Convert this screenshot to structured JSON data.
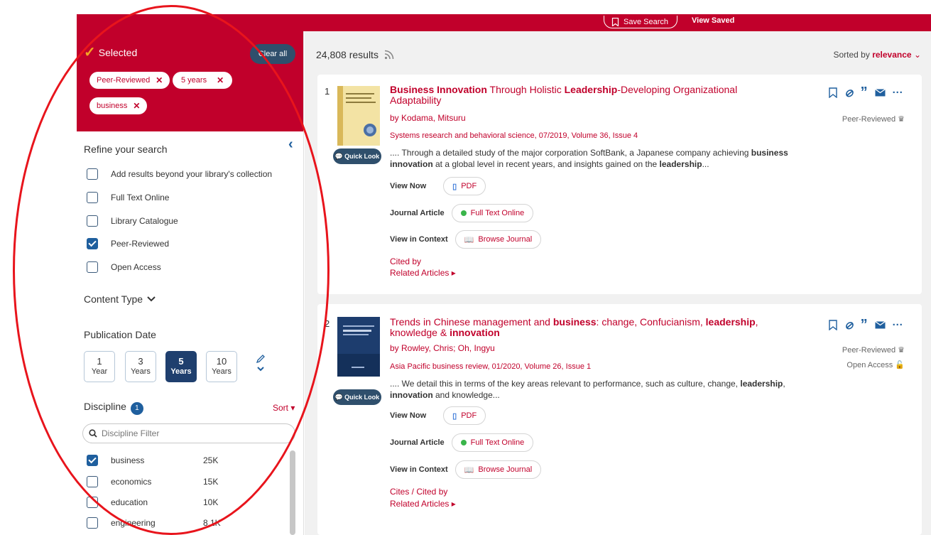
{
  "topbar": {
    "save_search": "Save Search",
    "view_saved": "View Saved"
  },
  "sidebar": {
    "selected_title": "Selected",
    "clear_all": "Clear all",
    "chips": [
      "Peer-Reviewed",
      "5 years",
      "business"
    ],
    "refine_title": "Refine your search",
    "filters": [
      {
        "label": "Add results beyond your library's collection",
        "checked": false
      },
      {
        "label": "Full Text Online",
        "checked": false
      },
      {
        "label": "Library Catalogue",
        "checked": false
      },
      {
        "label": "Peer-Reviewed",
        "checked": true
      },
      {
        "label": "Open Access",
        "checked": false
      }
    ],
    "content_type": "Content Type",
    "publication_date": "Publication Date",
    "years": [
      {
        "num": "1",
        "unit": "Year",
        "active": false
      },
      {
        "num": "3",
        "unit": "Years",
        "active": false
      },
      {
        "num": "5",
        "unit": "Years",
        "active": true
      },
      {
        "num": "10",
        "unit": "Years",
        "active": false
      }
    ],
    "discipline": "Discipline",
    "discipline_badge": "1",
    "sort_label": "Sort",
    "discipline_filter_placeholder": "Discipline Filter",
    "disciplines": [
      {
        "name": "business",
        "count": "25K",
        "checked": true
      },
      {
        "name": "economics",
        "count": "15K",
        "checked": false
      },
      {
        "name": "education",
        "count": "10K",
        "checked": false
      },
      {
        "name": "engineering",
        "count": "8.1K",
        "checked": false
      }
    ]
  },
  "results": {
    "count": "24,808 results",
    "sorted_by_label": "Sorted by",
    "sorted_by_value": "relevance",
    "items": [
      {
        "num": "1",
        "title_parts": [
          "Business Innovation",
          " Through Holistic ",
          "Leadership",
          "-Developing Organizational Adaptability"
        ],
        "author": "by Kodama, Mitsuru",
        "source": "Systems research and behavioral science, 07/2019, Volume 36, Issue 4",
        "snippet_parts": [
          ".... Through a detailed study of the major corporation SoftBank, a Japanese company achieving ",
          "business innovation",
          " at a global level in recent years, and insights gained on the ",
          "leadership",
          "..."
        ],
        "view_now": "View Now",
        "pdf": "PDF",
        "content_kind": "Journal Article",
        "full_text": "Full Text Online",
        "view_in_context": "View in Context",
        "browse_journal": "Browse Journal",
        "cited": "Cited by",
        "related": "Related Articles ▸",
        "meta": [
          "Peer-Reviewed"
        ],
        "quick_look": "Quick Look"
      },
      {
        "num": "2",
        "title_parts": [
          "Trends in Chinese management and ",
          "business",
          ": change, Confucianism, ",
          "leadership",
          ", knowledge & ",
          "innovation"
        ],
        "author": "by Rowley, Chris; Oh, Ingyu",
        "source": "Asia Pacific business review, 01/2020, Volume 26, Issue 1",
        "snippet_parts": [
          ".... We detail this in terms of the key areas relevant to performance, such as culture, change, ",
          "leadership",
          ", ",
          "innovation",
          " and knowledge..."
        ],
        "view_now": "View Now",
        "pdf": "PDF",
        "content_kind": "Journal Article",
        "full_text": "Full Text Online",
        "view_in_context": "View in Context",
        "browse_journal": "Browse Journal",
        "cited": "Cites / Cited by",
        "related": "Related Articles ▸",
        "meta": [
          "Peer-Reviewed",
          "Open Access"
        ],
        "quick_look": "Quick Look"
      }
    ]
  },
  "colors": {
    "brand_red": "#c1002b",
    "navy": "#1f3f6e",
    "annotation": "#e8141c"
  }
}
